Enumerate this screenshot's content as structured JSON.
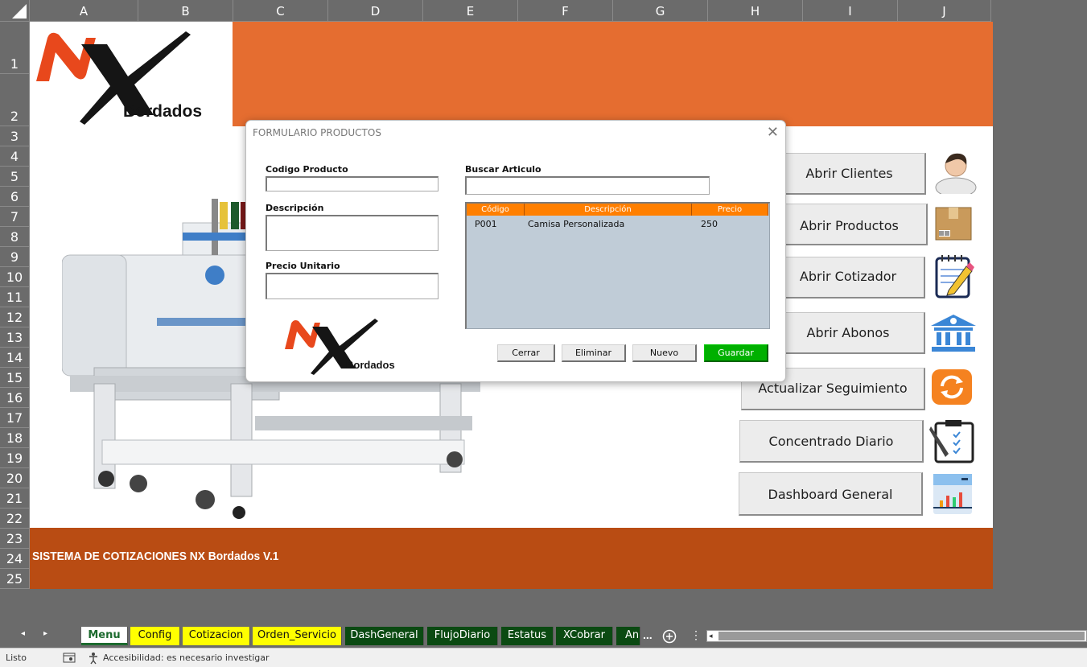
{
  "columns": [
    "A",
    "B",
    "C",
    "D",
    "E",
    "F",
    "G",
    "H",
    "I",
    "J"
  ],
  "rows": [
    "1",
    "2",
    "3",
    "4",
    "5",
    "6",
    "7",
    "8",
    "9",
    "10",
    "11",
    "12",
    "13",
    "14",
    "15",
    "16",
    "17",
    "18",
    "19",
    "20",
    "21",
    "22",
    "23",
    "24",
    "25"
  ],
  "logo": {
    "brand": "NX",
    "text": "Bordados"
  },
  "banner_text": "SISTEMA DE COTIZACIONES NX Bordados V.1",
  "menu_buttons": [
    {
      "label": "Abrir Clientes",
      "icon": "user-icon"
    },
    {
      "label": "Abrir Productos",
      "icon": "box-icon"
    },
    {
      "label": "Abrir Cotizador",
      "icon": "notepad-icon"
    },
    {
      "label": "Abrir Abonos",
      "icon": "bank-icon"
    },
    {
      "label": "Actualizar Seguimiento",
      "icon": "refresh-icon"
    },
    {
      "label": "Concentrado Diario",
      "icon": "clipboard-icon"
    },
    {
      "label": "Dashboard General",
      "icon": "chart-icon"
    }
  ],
  "dialog": {
    "title": "FORMULARIO PRODUCTOS",
    "close": "✕",
    "codigo_label": "Codigo Producto",
    "codigo_value": "",
    "descripcion_label": "Descripción",
    "descripcion_value": "",
    "precio_label": "Precio Unitario",
    "precio_value": "",
    "buscar_label": "Buscar Articulo",
    "buscar_value": "",
    "list_headers": [
      "Código",
      "Descripción",
      "Precio"
    ],
    "list_rows": [
      {
        "codigo": "P001",
        "descripcion": "Camisa Personalizada",
        "precio": "250"
      }
    ],
    "buttons": {
      "cerrar": "Cerrar",
      "eliminar": "Eliminar",
      "nuevo": "Nuevo",
      "guardar": "Guardar"
    }
  },
  "tabs": [
    {
      "label": "Menu",
      "style": "active"
    },
    {
      "label": "Config",
      "style": "yellow"
    },
    {
      "label": "Cotizacion",
      "style": "yellow"
    },
    {
      "label": "Orden_Servicio",
      "style": "yellow"
    },
    {
      "label": "DashGeneral",
      "style": "green"
    },
    {
      "label": "FlujoDiario",
      "style": "green"
    },
    {
      "label": "Estatus",
      "style": "green"
    },
    {
      "label": "XCobrar",
      "style": "green"
    },
    {
      "label": "An",
      "style": "green"
    }
  ],
  "tab_overflow": "...",
  "status": {
    "ready": "Listo",
    "accessibility": "Accesibilidad: es necesario investigar"
  },
  "colors": {
    "orange_top": "#e56d30",
    "orange_bottom": "#b94c13",
    "list_header": "#ff7f00",
    "guardar": "#00b000"
  }
}
